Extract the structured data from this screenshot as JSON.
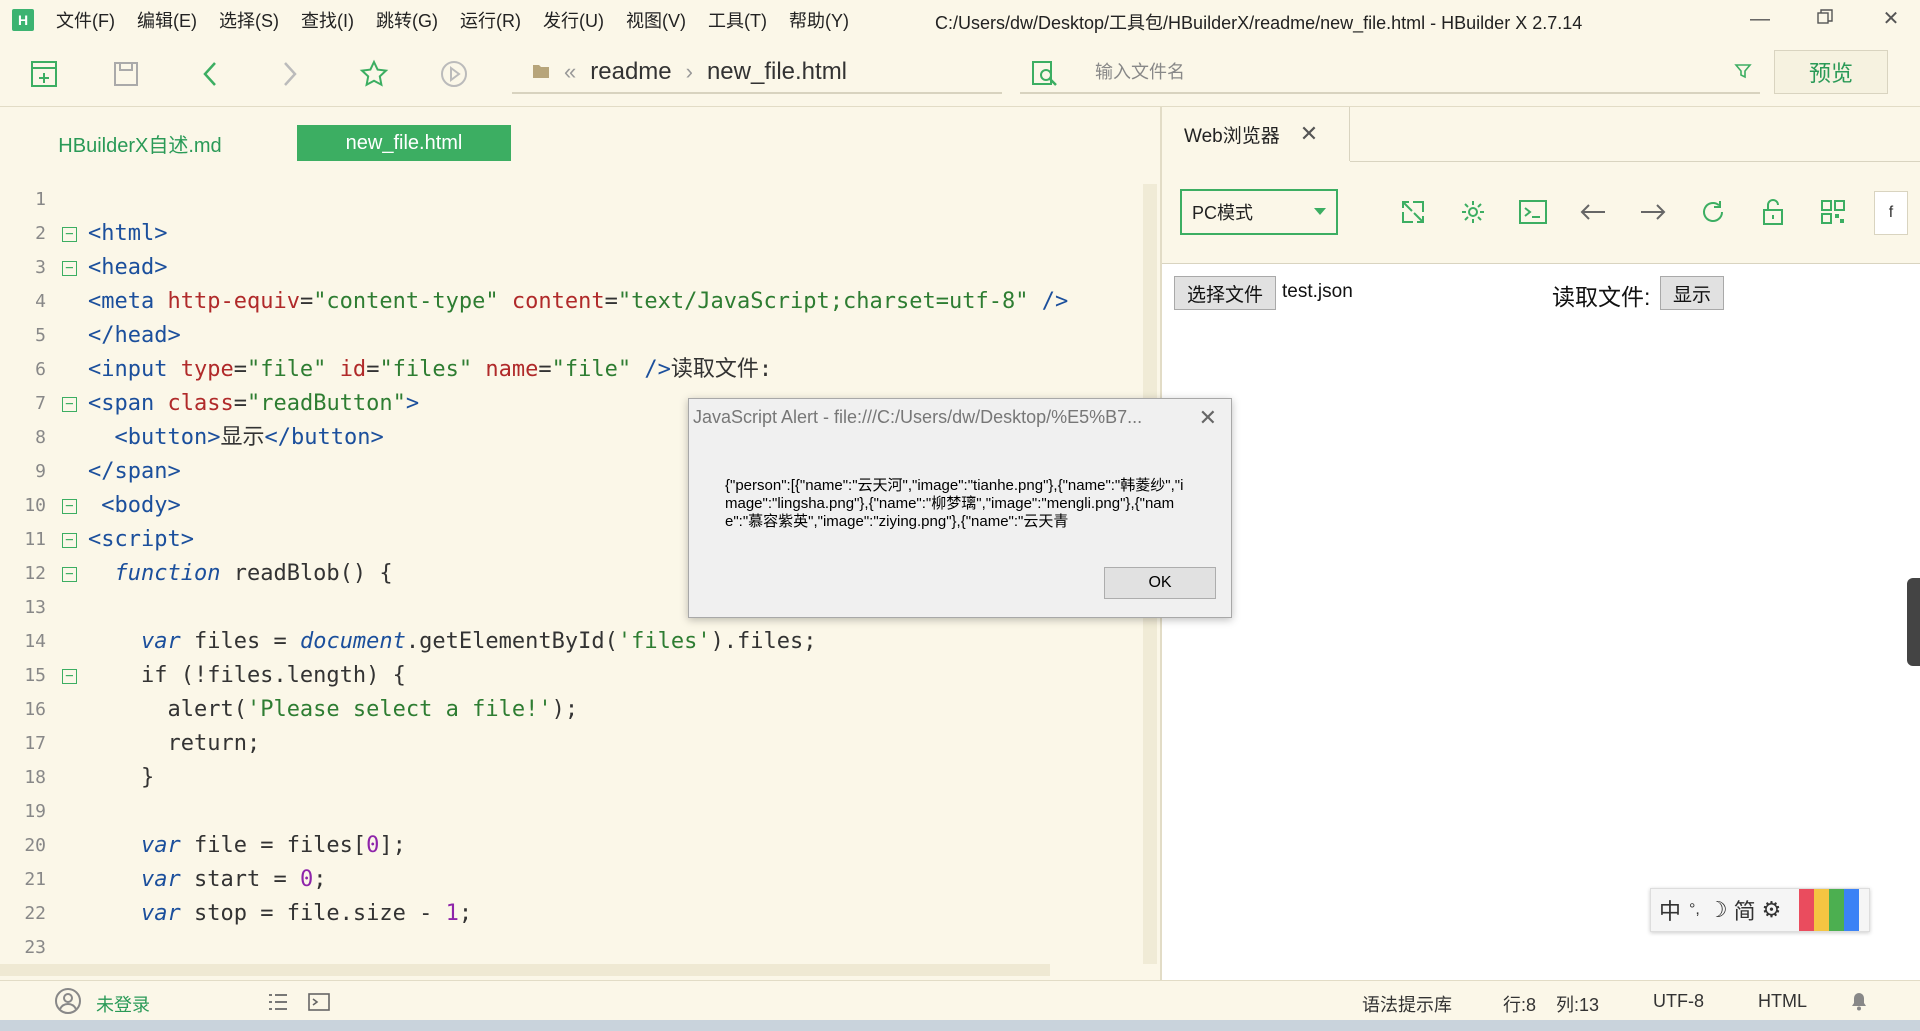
{
  "menubar": {
    "logo": "H",
    "items": [
      "文件(F)",
      "编辑(E)",
      "选择(S)",
      "查找(I)",
      "跳转(G)",
      "运行(R)",
      "发行(U)",
      "视图(V)",
      "工具(T)",
      "帮助(Y)"
    ],
    "window_title": "C:/Users/dw/Desktop/工具包/HBuilderX/readme/new_file.html - HBuilder X 2.7.14"
  },
  "toolbar": {
    "breadcrumb": [
      "readme",
      "new_file.html"
    ],
    "search_placeholder": "输入文件名",
    "preview_label": "预览"
  },
  "editor": {
    "tabs": [
      "HBuilderX自述.md",
      "new_file.html"
    ],
    "active_tab": 1
  },
  "browser": {
    "tab_label": "Web浏览器",
    "mode": "PC模式",
    "partial_button": "f",
    "choose_file_label": "选择文件",
    "chosen_file": "test.json",
    "read_label": "读取文件:",
    "show_button": "显示"
  },
  "alert": {
    "title": "JavaScript Alert - file:///C:/Users/dw/Desktop/%E5%B7...",
    "message": "{\"person\":[{\"name\":\"云天河\",\"image\":\"tianhe.png\"},{\"name\":\"韩菱纱\",\"image\":\"lingsha.png\"},{\"name\":\"柳梦璃\",\"image\":\"mengli.png\"},{\"name\":\"慕容紫英\",\"image\":\"ziying.png\"},{\"name\":\"云天青",
    "ok_label": "OK"
  },
  "statusbar": {
    "user": "未登录",
    "syntax": "语法提示库",
    "row": "行:8",
    "col": "列:13",
    "encoding": "UTF-8",
    "language": "HTML"
  },
  "ime": {
    "items": [
      "中",
      "°,",
      "☽",
      "简",
      "⚙"
    ]
  },
  "code_lines": [
    {
      "n": "1",
      "fold": false,
      "segs": []
    },
    {
      "n": "2",
      "fold": true,
      "segs": [
        [
          "tag",
          "<html>"
        ]
      ]
    },
    {
      "n": "3",
      "fold": true,
      "segs": [
        [
          "tag",
          "<head>"
        ]
      ]
    },
    {
      "n": "4",
      "fold": false,
      "segs": [
        [
          "tag",
          "<meta "
        ],
        [
          "attr",
          "http-equiv"
        ],
        [
          "p",
          "="
        ],
        [
          "str",
          "\"content-type\""
        ],
        [
          "p",
          " "
        ],
        [
          "attr",
          "content"
        ],
        [
          "p",
          "="
        ],
        [
          "str",
          "\"text/JavaScript;charset=utf-8\""
        ],
        [
          "p",
          " "
        ],
        [
          "tag",
          "/>"
        ]
      ]
    },
    {
      "n": "5",
      "fold": false,
      "segs": [
        [
          "tag",
          "</head>"
        ]
      ]
    },
    {
      "n": "6",
      "fold": false,
      "segs": [
        [
          "tag",
          "<input "
        ],
        [
          "attr",
          "type"
        ],
        [
          "p",
          "="
        ],
        [
          "str",
          "\"file\""
        ],
        [
          "p",
          " "
        ],
        [
          "attr",
          "id"
        ],
        [
          "p",
          "="
        ],
        [
          "str",
          "\"files\""
        ],
        [
          "p",
          " "
        ],
        [
          "attr",
          "name"
        ],
        [
          "p",
          "="
        ],
        [
          "str",
          "\"file\""
        ],
        [
          "p",
          " "
        ],
        [
          "tag",
          "/>"
        ],
        [
          "p",
          "读取文件:"
        ]
      ]
    },
    {
      "n": "7",
      "fold": true,
      "segs": [
        [
          "tag",
          "<span "
        ],
        [
          "attr",
          "class"
        ],
        [
          "p",
          "="
        ],
        [
          "str",
          "\"readButton\""
        ],
        [
          "tag",
          ">"
        ]
      ]
    },
    {
      "n": "8",
      "fold": false,
      "segs": [
        [
          "p",
          "  "
        ],
        [
          "tag",
          "<button>"
        ],
        [
          "p",
          "显示"
        ],
        [
          "tag",
          "</button>"
        ]
      ]
    },
    {
      "n": "9",
      "fold": false,
      "segs": [
        [
          "tag",
          "</span>"
        ]
      ]
    },
    {
      "n": "10",
      "fold": true,
      "segs": [
        [
          "p",
          " "
        ],
        [
          "tag",
          "<body>"
        ]
      ]
    },
    {
      "n": "11",
      "fold": true,
      "segs": [
        [
          "tag",
          "<script>"
        ]
      ]
    },
    {
      "n": "12",
      "fold": true,
      "segs": [
        [
          "p",
          "  "
        ],
        [
          "kw",
          "function"
        ],
        [
          "p",
          " readBlob() {"
        ]
      ]
    },
    {
      "n": "13",
      "fold": false,
      "segs": []
    },
    {
      "n": "14",
      "fold": false,
      "segs": [
        [
          "p",
          "    "
        ],
        [
          "kw",
          "var"
        ],
        [
          "p",
          " files = "
        ],
        [
          "kw",
          "document"
        ],
        [
          "p",
          ".getElementById("
        ],
        [
          "str",
          "'files'"
        ],
        [
          "p",
          ").files;"
        ]
      ]
    },
    {
      "n": "15",
      "fold": true,
      "segs": [
        [
          "p",
          "    if (!files.length) {"
        ]
      ]
    },
    {
      "n": "16",
      "fold": false,
      "segs": [
        [
          "p",
          "      alert("
        ],
        [
          "str",
          "'Please select a file!'"
        ],
        [
          "p",
          ");"
        ]
      ]
    },
    {
      "n": "17",
      "fold": false,
      "segs": [
        [
          "p",
          "      return;"
        ]
      ]
    },
    {
      "n": "18",
      "fold": false,
      "segs": [
        [
          "p",
          "    }"
        ]
      ]
    },
    {
      "n": "19",
      "fold": false,
      "segs": []
    },
    {
      "n": "20",
      "fold": false,
      "segs": [
        [
          "p",
          "    "
        ],
        [
          "kw",
          "var"
        ],
        [
          "p",
          " file = files["
        ],
        [
          "num",
          "0"
        ],
        [
          "p",
          "];"
        ]
      ]
    },
    {
      "n": "21",
      "fold": false,
      "segs": [
        [
          "p",
          "    "
        ],
        [
          "kw",
          "var"
        ],
        [
          "p",
          " start = "
        ],
        [
          "num",
          "0"
        ],
        [
          "p",
          ";"
        ]
      ]
    },
    {
      "n": "22",
      "fold": false,
      "segs": [
        [
          "p",
          "    "
        ],
        [
          "kw",
          "var"
        ],
        [
          "p",
          " stop = file.size - "
        ],
        [
          "num",
          "1"
        ],
        [
          "p",
          ";"
        ]
      ]
    },
    {
      "n": "23",
      "fold": false,
      "segs": []
    }
  ]
}
